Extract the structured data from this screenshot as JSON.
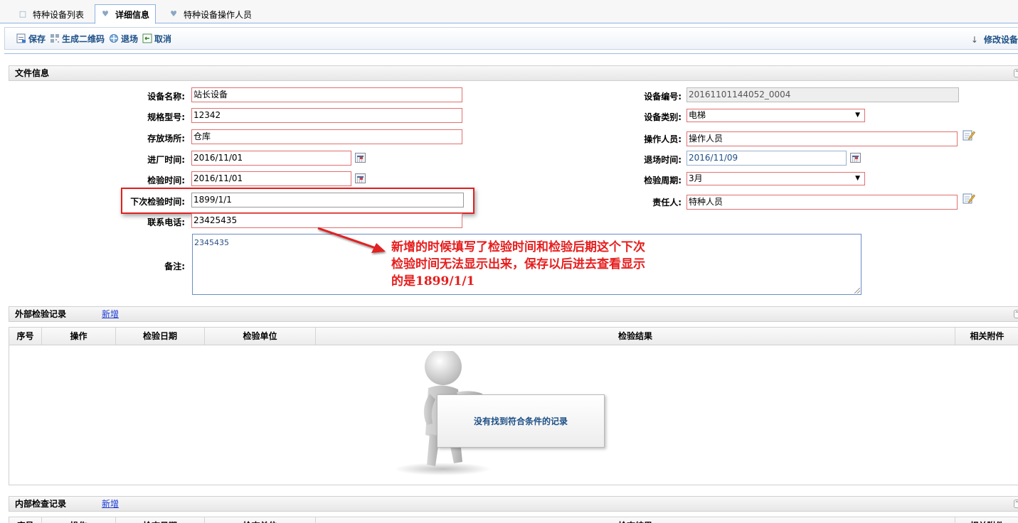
{
  "tabs": [
    {
      "label": "特种设备列表",
      "icon": "document-icon"
    },
    {
      "label": "详细信息",
      "icon": "link-icon"
    },
    {
      "label": "特种设备操作人员",
      "icon": "link-icon"
    }
  ],
  "toolbar": {
    "save": "保存",
    "qrcode": "生成二维码",
    "exit": "退场",
    "cancel": "取消",
    "right_label": "修改设备"
  },
  "file_info": {
    "title": "文件信息",
    "device_name_label": "设备名称:",
    "device_name": "站长设备",
    "model_label": "规格型号:",
    "model": "12342",
    "location_label": "存放场所:",
    "location": "仓库",
    "entry_label": "进厂时间:",
    "entry": "2016/11/01",
    "inspect_label": "检验时间:",
    "inspect": "2016/11/01",
    "next_inspect_label": "下次检验时间:",
    "next_inspect": "1899/1/1",
    "phone_label": "联系电话:",
    "phone": "23425435",
    "remark_label": "备注:",
    "remark": "2345435",
    "device_no_label": "设备编号:",
    "device_no": "20161101144052_0004",
    "category_label": "设备类别:",
    "category": "电梯",
    "operator_label": "操作人员:",
    "operator": "操作人员",
    "exit_time_label": "退场时间:",
    "exit_time": "2016/11/09",
    "period_label": "检验周期:",
    "period": "3月",
    "owner_label": "责任人:",
    "owner": "特种人员"
  },
  "annotation": {
    "line1": "新增的时候填写了检验时间和检验后期这个下次",
    "line2": "检验时间无法显示出来，保存以后进去查看显示",
    "line3": "的是1899/1/1"
  },
  "external": {
    "title": "外部检验记录",
    "add": "新增",
    "columns": [
      "序号",
      "操作",
      "检验日期",
      "检验单位",
      "检验结果",
      "相关附件"
    ],
    "empty": "没有找到符合条件的记录"
  },
  "internal": {
    "title": "内部检查记录",
    "add": "新增",
    "columns": [
      "序号",
      "操作",
      "检查日期",
      "检查单位",
      "检查结果",
      "相关附件"
    ]
  },
  "colors": {
    "accent": "#1c4f86",
    "required_border": "#e07070",
    "annotation": "#e61e1e"
  }
}
